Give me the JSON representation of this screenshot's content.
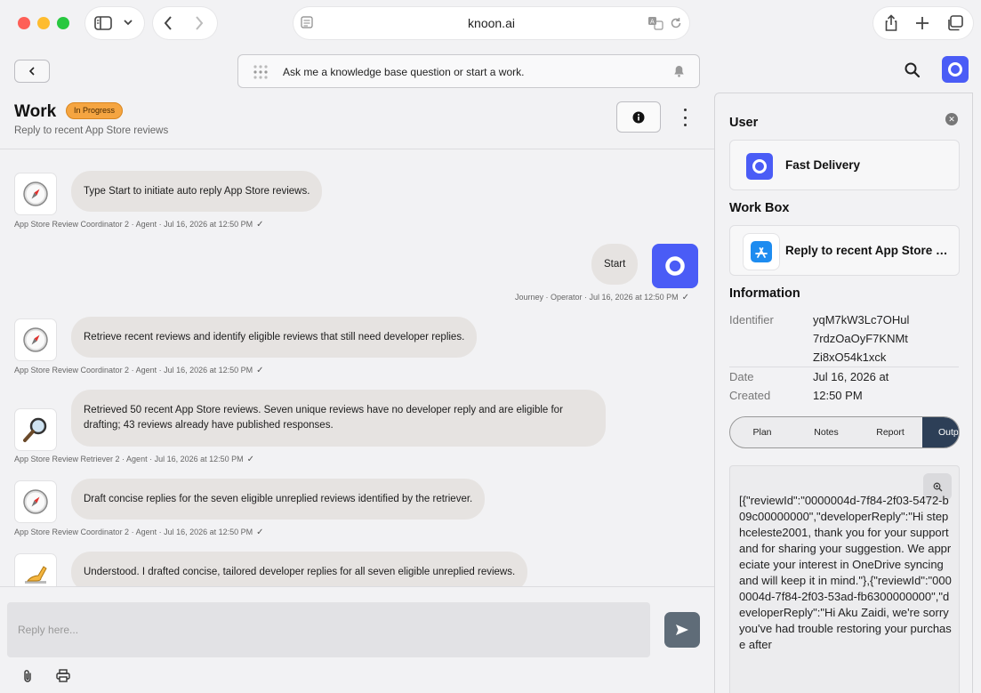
{
  "browser": {
    "url": "knoon.ai"
  },
  "topbar": {
    "ask_placeholder": "Ask me a knowledge base question or start a work."
  },
  "work": {
    "title": "Work",
    "status": "In Progress",
    "subtitle": "Reply to recent App Store reviews"
  },
  "messages": [
    {
      "text": "Type Start to initiate auto reply App Store reviews.",
      "meta": "App Store Review Coordinator 2 · Agent · Jul 16, 2026 at 12:50 PM",
      "icon": "compass-icon"
    },
    {
      "text": "Start",
      "meta": "Journey · Operator · Jul 16, 2026 at 12:50 PM",
      "icon": "user-avatar"
    },
    {
      "text": "Retrieve recent reviews and identify eligible reviews that still need developer replies.",
      "meta": "App Store Review Coordinator 2 · Agent · Jul 16, 2026 at 12:50 PM",
      "icon": "compass-icon"
    },
    {
      "text": "Retrieved 50 recent App Store reviews. Seven unique reviews have no developer reply and are eligible for drafting; 43 reviews already have published responses.",
      "meta": "App Store Review Retriever 2 · Agent · Jul 16, 2026 at 12:50 PM",
      "icon": "magnifier-icon"
    },
    {
      "text": "Draft concise replies for the seven eligible unreplied reviews identified by the retriever.",
      "meta": "App Store Review Coordinator 2 · Agent · Jul 16, 2026 at 12:50 PM",
      "icon": "compass-icon"
    },
    {
      "text": "Understood. I drafted concise, tailored developer replies for all seven eligible unreplied reviews.",
      "meta": "",
      "icon": "writing-hand-icon"
    }
  ],
  "composer": {
    "placeholder": "Reply here..."
  },
  "panel": {
    "user_title": "User",
    "user_name": "Fast Delivery",
    "workbox_title": "Work Box",
    "workbox_name": "Reply to recent App Store reviews",
    "info_title": "Information",
    "identifier_label": "Identifier",
    "identifier_lines": [
      "yqM7kW3Lc7OHul",
      "7rdzOaOyF7KNMt",
      "Zi8xO54k1xck"
    ],
    "date_label_lines": [
      "Date",
      "Created"
    ],
    "date_value_lines": [
      "Jul 16, 2026 at",
      "12:50 PM"
    ],
    "tabs": [
      "Plan",
      "Notes",
      "Report",
      "Outp"
    ],
    "active_tab": "Outp",
    "output_text": "[{\"reviewId\":\"0000004d-7f84-2f03-5472-b09c00000000\",\"developerReply\":\"Hi stephceleste2001, thank you for your support and for sharing your suggestion. We appreciate your interest in OneDrive syncing and will keep it in mind.\"},{\"reviewId\":\"0000004d-7f84-2f03-53ad-fb6300000000\",\"developerReply\":\"Hi Aku Zaidi, we're sorry you've had trouble restoring your purchase after"
  },
  "colors": {
    "accent": "#4a5cf6",
    "status_badge": "#f5a541",
    "active_tab": "#2d3f57",
    "bubble": "#e6e3e1"
  }
}
